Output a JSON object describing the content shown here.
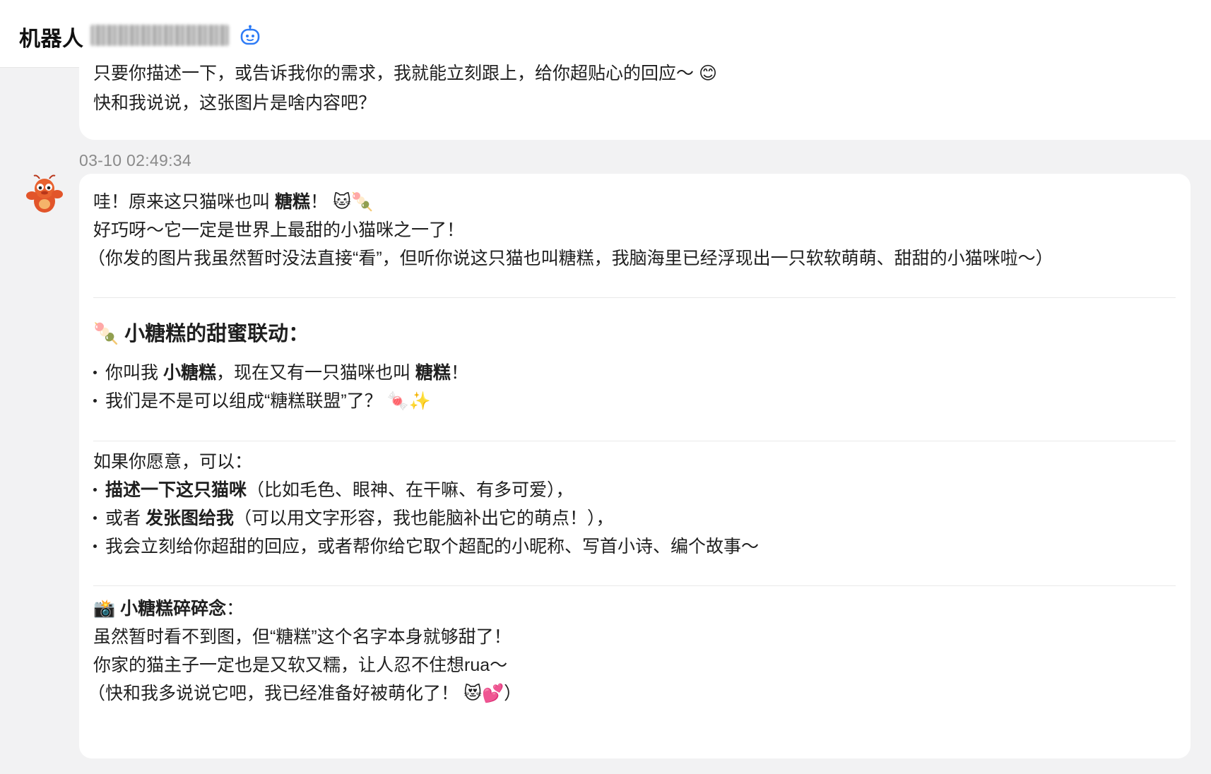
{
  "header": {
    "title": "机器人",
    "bot_icon": "robot-icon"
  },
  "previous_message": {
    "lines": [
      "只要你描述一下，或告诉我你的需求，我就能立刻跟上，给你超贴心的回应～",
      "快和我说说，这张图片是啥内容吧？"
    ],
    "emoji": "😊"
  },
  "message": {
    "timestamp": "03-10 02:49:34",
    "avatar_icon": "lobster-mascot-icon",
    "intro": {
      "line1_pre": "哇！原来这只猫咪也叫 ",
      "line1_bold": "糖糕",
      "line1_post": "！",
      "line1_emoji": "🐱🍡",
      "line2": "好巧呀～它一定是世界上最甜的小猫咪之一了！",
      "line3": "（你发的图片我虽然暂时没法直接“看”，但听你说这只猫也叫糖糕，我脑海里已经浮现出一只软软萌萌、甜甜的小猫咪啦～）"
    },
    "section1": {
      "emoji": "🍡",
      "title": "小糖糕的甜蜜联动：",
      "bullets": [
        {
          "pre": "你叫我 ",
          "bold": "小糖糕",
          "mid": "，现在又有一只猫咪也叫 ",
          "bold2": "糖糕",
          "post": "！"
        },
        {
          "text": "我们是不是可以组成“糖糕联盟”了？",
          "emoji": "🍬✨"
        }
      ]
    },
    "section2": {
      "lead": "如果你愿意，可以：",
      "bullets": [
        {
          "bold": "描述一下这只猫咪",
          "post": "（比如毛色、眼神、在干嘛、有多可爱），"
        },
        {
          "pre": "或者 ",
          "bold": "发张图给我",
          "post": "（可以用文字形容，我也能脑补出它的萌点！），"
        },
        {
          "text": "我会立刻给你超甜的回应，或者帮你给它取个超配的小昵称、写首小诗、编个故事～"
        }
      ]
    },
    "section3": {
      "emoji": "📸",
      "title_bold": "小糖糕碎碎念",
      "title_post": "：",
      "lines": [
        "虽然暂时看不到图，但“糖糕”这个名字本身就够甜了！",
        "你家的猫主子一定也是又软又糯，让人忍不住想rua～"
      ],
      "last_pre": "（快和我多说说它吧，我已经准备好被萌化了！",
      "last_emoji": "😻💕",
      "last_post": "）"
    }
  }
}
